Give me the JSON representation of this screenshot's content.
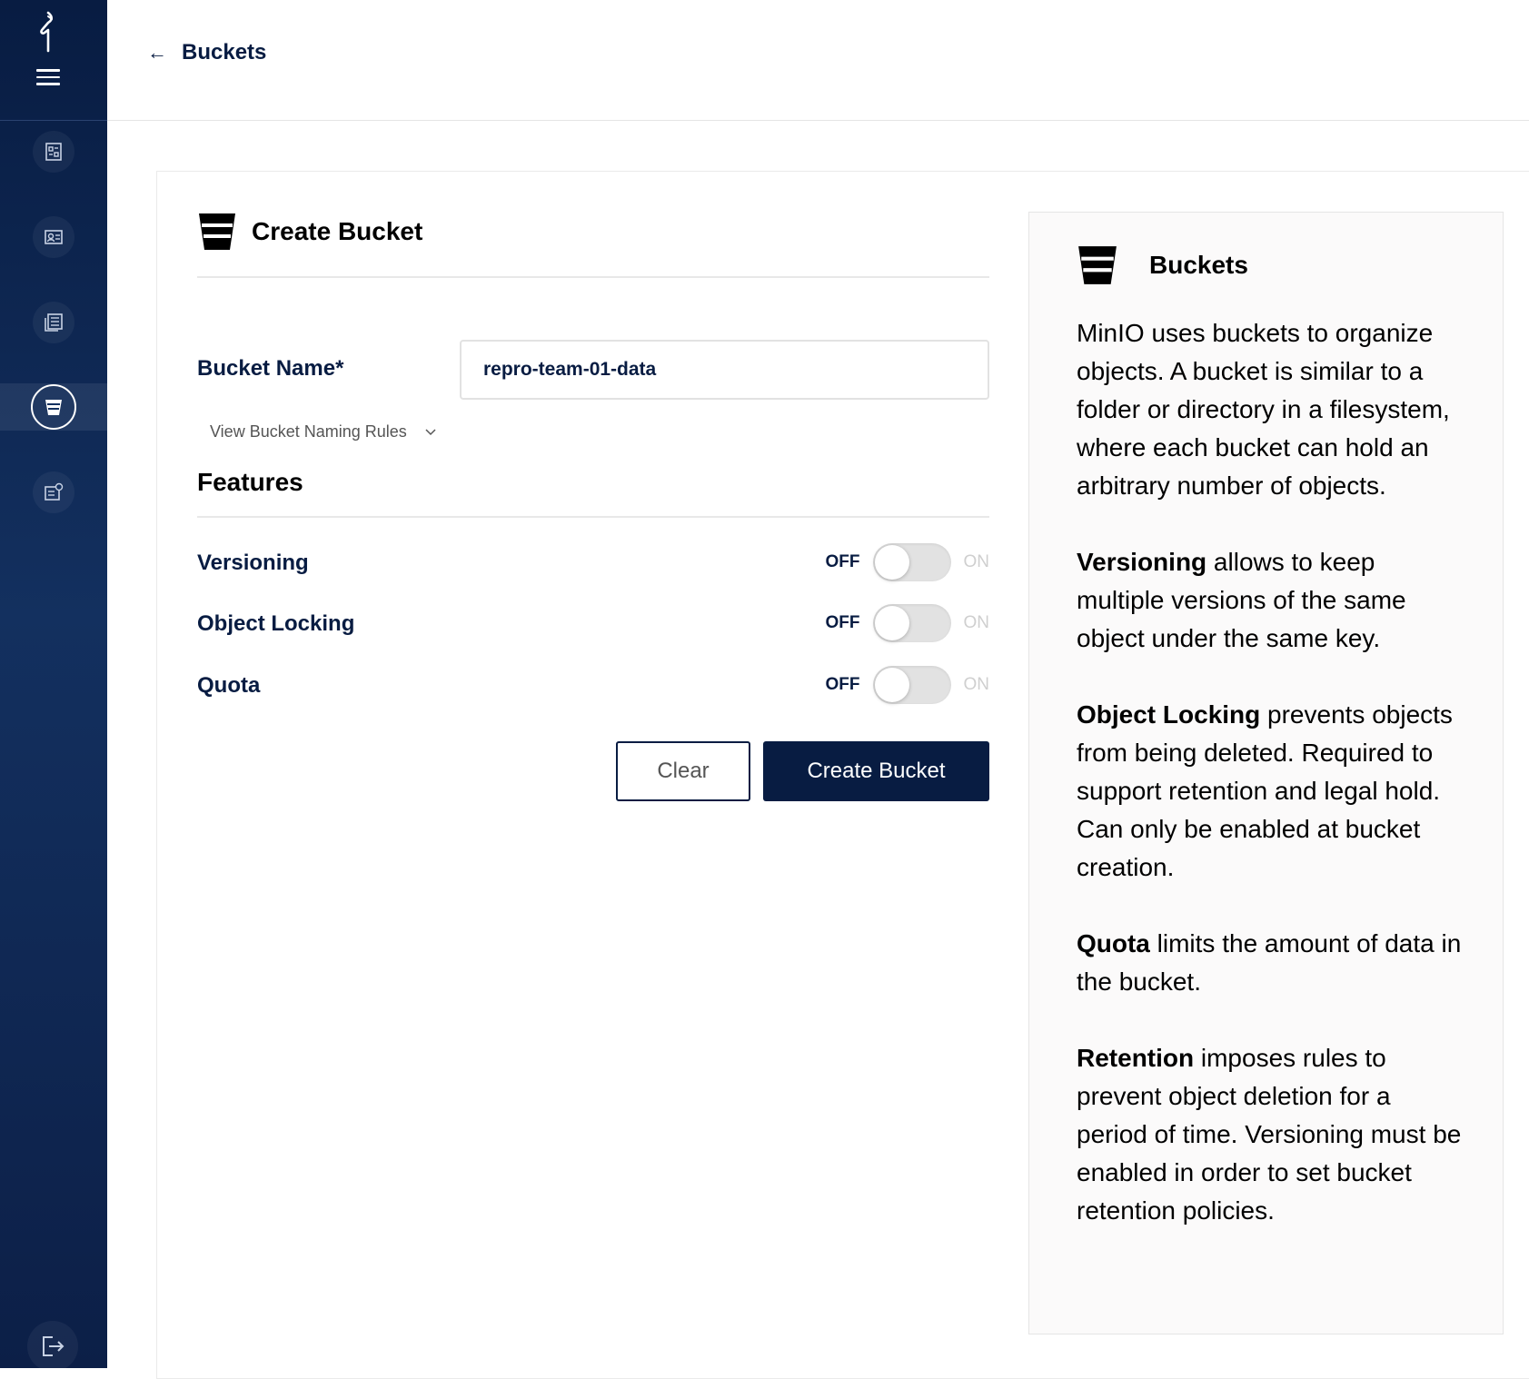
{
  "header": {
    "back_label": "Buckets"
  },
  "sidebar": {
    "items": [
      {
        "icon": "dashboard-icon"
      },
      {
        "icon": "identity-icon"
      },
      {
        "icon": "logs-icon"
      },
      {
        "icon": "bucket-icon",
        "active": true
      },
      {
        "icon": "settings-icon"
      }
    ],
    "logout_icon": "logout-icon"
  },
  "form": {
    "title": "Create Bucket",
    "bucket_name_label": "Bucket Name*",
    "bucket_name_value": "repro-team-01-data",
    "naming_rules_link": "View Bucket Naming Rules",
    "features_title": "Features",
    "toggles": [
      {
        "name": "Versioning",
        "off": "OFF",
        "on": "ON",
        "state": false
      },
      {
        "name": "Object Locking",
        "off": "OFF",
        "on": "ON",
        "state": false
      },
      {
        "name": "Quota",
        "off": "OFF",
        "on": "ON",
        "state": false
      }
    ],
    "clear_label": "Clear",
    "create_label": "Create Bucket"
  },
  "help": {
    "title": "Buckets",
    "intro": "MinIO uses buckets to organize objects. A bucket is similar to a folder or directory in a filesystem, where each bucket can hold an arbitrary number of objects.",
    "sections": [
      {
        "term": "Versioning",
        "text": " allows to keep multiple versions of the same object under the same key."
      },
      {
        "term": "Object Locking",
        "text": " prevents objects from being deleted. Required to support retention and legal hold. Can only be enabled at bucket creation."
      },
      {
        "term": "Quota",
        "text": " limits the amount of data in the bucket."
      },
      {
        "term": "Retention",
        "text": " imposes rules to prevent object deletion for a period of time. Versioning must be enabled in order to set bucket retention policies."
      }
    ]
  },
  "colors": {
    "primary": "#081c42",
    "sidebar_gradient_mid": "#13305f",
    "switch_track": "#e2e2e2",
    "help_bg": "#fbfafa"
  }
}
